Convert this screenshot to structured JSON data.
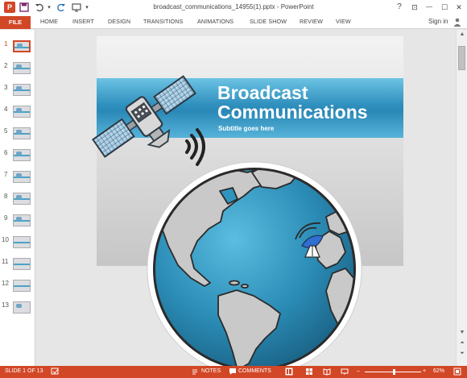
{
  "window": {
    "title": "broadcast_communications_14955(1).pptx - PowerPoint",
    "logo_glyph": "P",
    "controls": {
      "help": "?",
      "restore_ribbon": "⊡",
      "minimize": "—",
      "maximize": "☐",
      "close": "✕"
    }
  },
  "quick_access": {
    "save_icon": "save-icon",
    "undo_icon": "undo-icon",
    "redo_icon": "redo-icon",
    "present_icon": "start-from-beginning-icon",
    "customize": "▾"
  },
  "ribbon": {
    "file_tab": "FILE",
    "tabs": [
      "HOME",
      "INSERT",
      "DESIGN",
      "TRANSITIONS",
      "ANIMATIONS",
      "SLIDE SHOW",
      "REVIEW",
      "VIEW"
    ],
    "sign_in": "Sign in"
  },
  "thumbnails": {
    "numbers": [
      "1",
      "2",
      "3",
      "4",
      "5",
      "6",
      "7",
      "8",
      "9",
      "10",
      "11",
      "12",
      "13"
    ],
    "selected": "1"
  },
  "slide": {
    "title_line1": "Broadcast",
    "title_line2": "Communications",
    "subtitle": "Subtitle goes here"
  },
  "statusbar": {
    "slide_indicator": "SLIDE 1 OF 13",
    "notes": "NOTES",
    "comments": "COMMENTS",
    "zoom": "62%",
    "zoom_minus": "–",
    "zoom_plus": "+",
    "zoom_fraction": 0.5
  },
  "colors": {
    "accent": "#d24726",
    "title_band": "#2f8fbd",
    "ocean": "#2b8cb6",
    "land": "#c9c9c9"
  }
}
